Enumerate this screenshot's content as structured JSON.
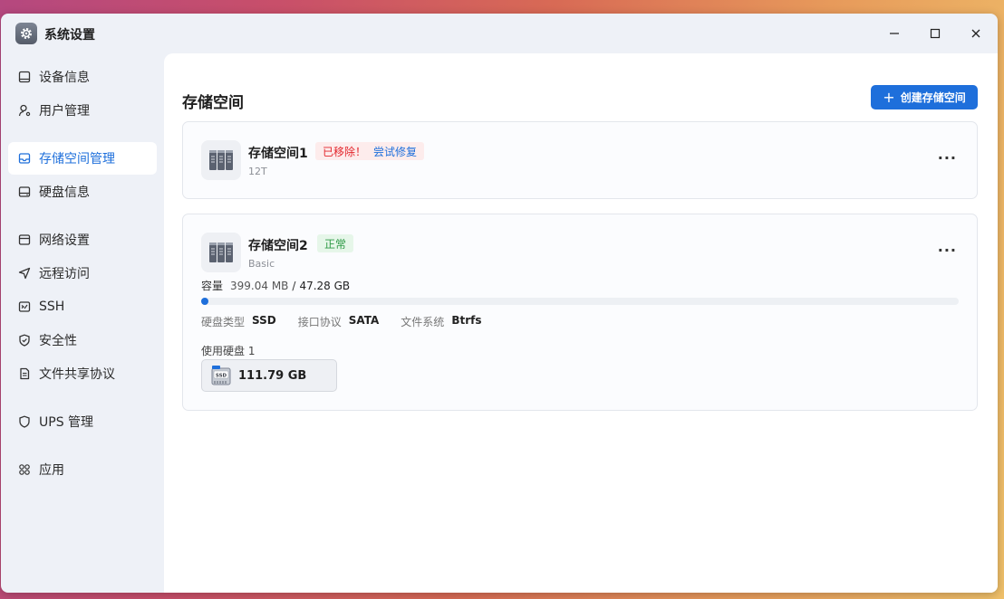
{
  "window": {
    "title": "系统设置",
    "icon": "gear-icon",
    "controls": [
      "minimize-icon",
      "maximize-icon",
      "close-icon"
    ]
  },
  "sidebar": {
    "items": [
      {
        "label": "设备信息",
        "icon": "device-info-icon",
        "active": false
      },
      {
        "label": "用户管理",
        "icon": "user-icon",
        "active": false
      },
      {
        "label": "存储空间管理",
        "icon": "storage-icon",
        "active": true
      },
      {
        "label": "硬盘信息",
        "icon": "disk-icon",
        "active": false
      },
      {
        "label": "网络设置",
        "icon": "network-icon",
        "active": false
      },
      {
        "label": "远程访问",
        "icon": "remote-access-icon",
        "active": false
      },
      {
        "label": "SSH",
        "icon": "terminal-icon",
        "active": false
      },
      {
        "label": "安全性",
        "icon": "shield-check-icon",
        "active": false
      },
      {
        "label": "文件共享协议",
        "icon": "document-icon",
        "active": false
      },
      {
        "label": "UPS 管理",
        "icon": "shield-icon",
        "active": false
      },
      {
        "label": "应用",
        "icon": "apps-icon",
        "active": false
      }
    ]
  },
  "main": {
    "title": "存储空间",
    "create_button": {
      "plus": "+",
      "label": "创建存储空间"
    },
    "pools": [
      {
        "name": "存储空间1",
        "sub": "12T",
        "status_error": "已移除！",
        "status_action": "尝试修复",
        "more": "···"
      },
      {
        "name": "存储空间2",
        "sub": "Basic",
        "status": "正常",
        "more": "···",
        "capacity_label": "容量",
        "capacity_used": "399.04 MB",
        "capacity_sep": "/",
        "capacity_total": "47.28 GB",
        "usage_fraction": 0.008,
        "disk_type_label": "硬盘类型",
        "disk_type": "SSD",
        "interface_label": "接口协议",
        "interface": "SATA",
        "fs_label": "文件系统",
        "fs": "Btrfs",
        "disks_label": "使用硬盘 1",
        "disk_size": "111.79 GB",
        "disk_icon_text": "SSD"
      }
    ]
  },
  "colors": {
    "accent": "#1e6fdb",
    "error": "#e3262c",
    "ok": "#2f9a46"
  }
}
